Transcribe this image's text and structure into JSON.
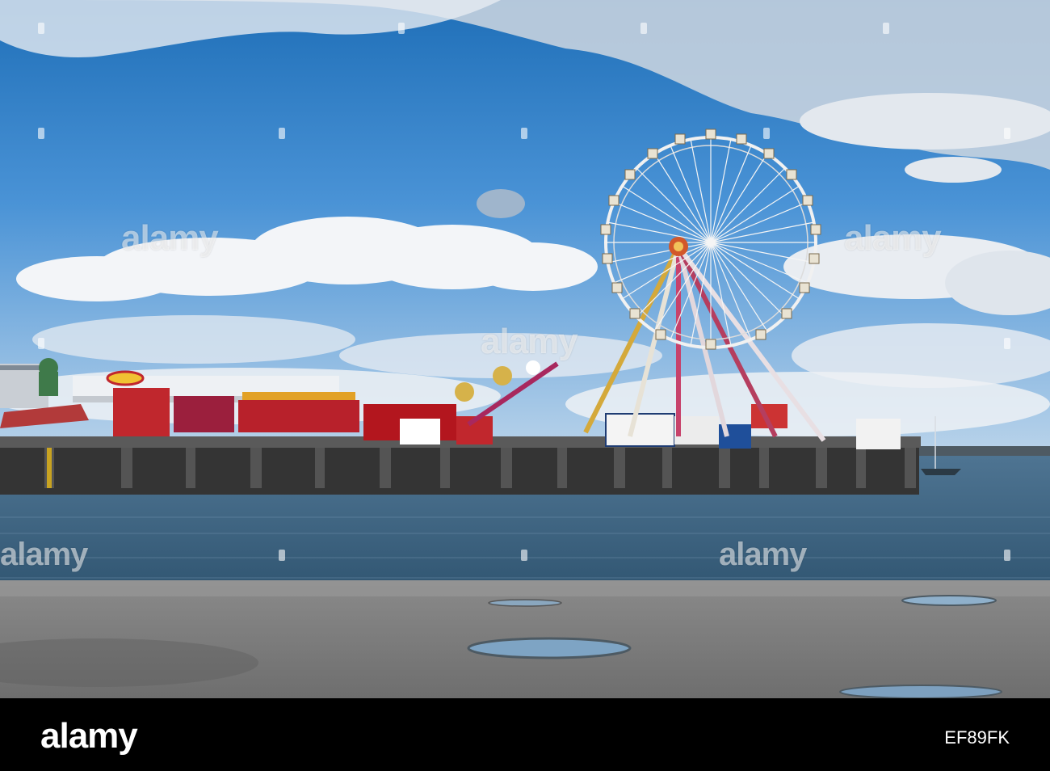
{
  "watermark": {
    "text": "alamy"
  },
  "footer": {
    "brand": "alamy",
    "image_code": "EF89FK"
  },
  "colors": {
    "sky_top": "#1f6fb8",
    "sky_mid": "#4a93d6",
    "sky_low": "#a9c9e6",
    "water": "#3f6480",
    "pier": "#3b3b3b",
    "promenade": "#7b7b7b",
    "footer_bg": "#000000"
  }
}
